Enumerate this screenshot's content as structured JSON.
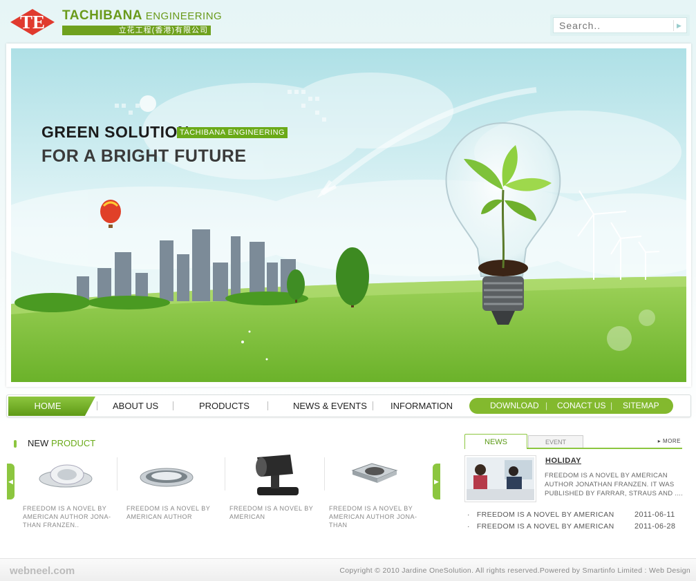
{
  "brand": {
    "name_bold": "TACHIBANA",
    "name_light": " ENGINEERING",
    "subtitle": "立花工程(香港)有限公司",
    "logo_icon": "te-diamond-logo"
  },
  "search": {
    "placeholder": "Search.."
  },
  "banner": {
    "headline": "GREEN SOLUTION",
    "tag": "TACHIBANA ENGINEERING",
    "subline": "FOR A BRIGHT FUTURE"
  },
  "nav": {
    "home": "HOME",
    "items": [
      "ABOUT US",
      "PRODUCTS",
      "NEWS & EVENTS",
      "INFORMATION"
    ],
    "right": [
      "DOWNLOAD",
      "CONACT US",
      "SITEMAP"
    ]
  },
  "new_product": {
    "title_a": "NEW ",
    "title_b": "PRODUCT",
    "items": [
      {
        "caption": "FREEDOM IS A NOVEL BY AMERICAN AUTHOR JONA-THAN FRANZEN..",
        "icon": "recessed-spotlight-icon"
      },
      {
        "caption": "FREEDOM IS A NOVEL BY AMERICAN AUTHOR",
        "icon": "downlight-icon"
      },
      {
        "caption": "FREEDOM IS A NOVEL BY AMERICAN",
        "icon": "projector-spotlight-icon"
      },
      {
        "caption": "FREEDOM IS A NOVEL BY AMERICAN AUTHOR JONA-THAN",
        "icon": "square-downlight-icon"
      }
    ]
  },
  "news": {
    "tab_news": "NEWS",
    "tab_event": "EVENT",
    "more": "▸ MORE",
    "headline": "HOLIDAY",
    "summary": "FREEDOM IS A NOVEL BY AMERICAN AUTHOR JONATHAN FRANZEN. IT WAS PUBLISHED BY FARRAR, STRAUS AND ....",
    "list": [
      {
        "title": "FREEDOM IS A NOVEL BY AMERICAN",
        "date": "2011-06-11"
      },
      {
        "title": "FREEDOM IS A NOVEL BY AMERICAN",
        "date": "2011-06-28"
      }
    ]
  },
  "footer": {
    "watermark": "webneel.com",
    "copyright": "Copyright © 2010 Jardine OneSolution. All rights reserved.Powered by Smartinfo Limited : Web Design"
  },
  "colors": {
    "brand_green": "#6aaa18",
    "nav_green": "#8cc63f",
    "logo_red": "#e03a2e"
  }
}
